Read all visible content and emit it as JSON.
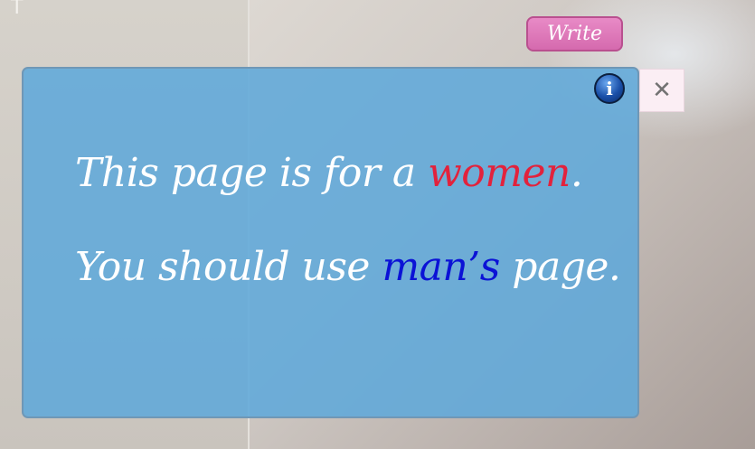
{
  "background": {
    "left_mark": "T"
  },
  "header": {
    "write_label": "Write"
  },
  "dialog": {
    "info_icon_glyph": "i",
    "close_glyph": "✕",
    "line1": {
      "before": "This page is for a ",
      "highlight": "women",
      "after": "."
    },
    "line2": {
      "before": "You should use ",
      "highlight": "man’s",
      "after": " page."
    }
  },
  "colors": {
    "dialog_bg": "#60a8da",
    "write_button": "#d56aae",
    "highlight_red": "#e2223c",
    "highlight_blue": "#0b12d6",
    "close_button_bg": "#fbeef4"
  },
  "icons": {
    "info": "info-icon",
    "close": "close-icon"
  }
}
